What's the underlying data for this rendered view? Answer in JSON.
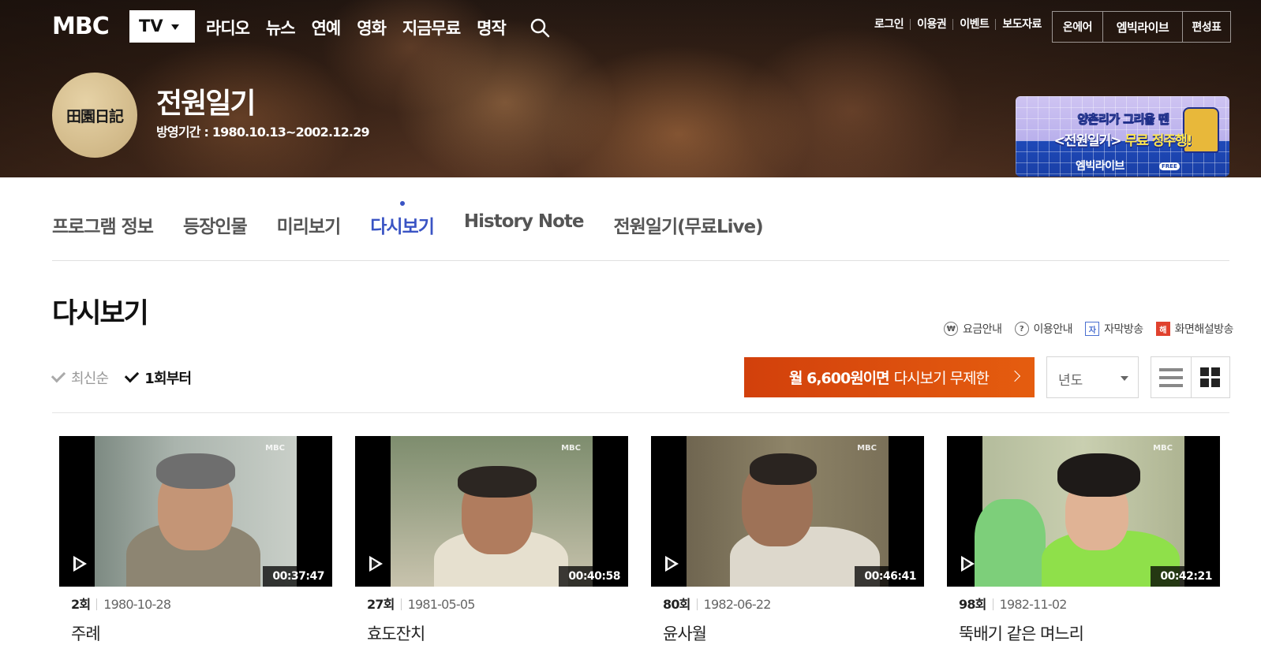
{
  "header": {
    "logo": "MBC",
    "channel_select": "TV",
    "main_nav": [
      "라디오",
      "뉴스",
      "연예",
      "영화",
      "지금무료",
      "명작"
    ],
    "util_links": [
      "로그인",
      "이용권",
      "이벤트",
      "보도자료"
    ],
    "util_buttons": [
      "온에어",
      "엠빅라이브",
      "편성표"
    ]
  },
  "program": {
    "logo_text": "田園日記",
    "title": "전원일기",
    "period": "방영기간 : 1980.10.13~2002.12.29"
  },
  "banner": {
    "line1": "양촌리가 그리울 땐",
    "line2_prefix": "<전원일기> ",
    "line2_highlight": "무료 정주행!",
    "line3": "엠빅라이브",
    "badge": "FREE"
  },
  "tabs": [
    {
      "label": "프로그램 정보",
      "active": false
    },
    {
      "label": "등장인물",
      "active": false
    },
    {
      "label": "미리보기",
      "active": false
    },
    {
      "label": "다시보기",
      "active": true
    },
    {
      "label": "History Note",
      "active": false
    },
    {
      "label": "전원일기(무료Live)",
      "active": false
    }
  ],
  "section": {
    "title": "다시보기",
    "legend": [
      {
        "icon": "won",
        "label": "요금안내"
      },
      {
        "icon": "?",
        "label": "이용안내"
      },
      {
        "icon": "자",
        "label": "자막방송"
      },
      {
        "icon": "해",
        "label": "화면해설방송"
      }
    ]
  },
  "filters": {
    "sort_options": [
      {
        "label": "최신순",
        "selected": false
      },
      {
        "label": "1회부터",
        "selected": true
      }
    ],
    "promo_bold": "월 6,600원이면",
    "promo_rest": "다시보기 무제한",
    "year_placeholder": "년도",
    "view_mode": "grid"
  },
  "episodes": [
    {
      "ep": "2회",
      "date": "1980-10-28",
      "title": "주례",
      "duration": "00:37:47"
    },
    {
      "ep": "27회",
      "date": "1981-05-05",
      "title": "효도잔치",
      "duration": "00:40:58"
    },
    {
      "ep": "80회",
      "date": "1982-06-22",
      "title": "윤사월",
      "duration": "00:46:41"
    },
    {
      "ep": "98회",
      "date": "1982-11-02",
      "title": "뚝배기 같은 며느리",
      "duration": "00:42:21"
    }
  ],
  "thumb_watermark": "MBC",
  "colors": {
    "accent": "#3a54c4",
    "promo": "#d2400c",
    "subtitle_badge": "#4a6fd0",
    "audio_desc_badge": "#e0412e"
  }
}
